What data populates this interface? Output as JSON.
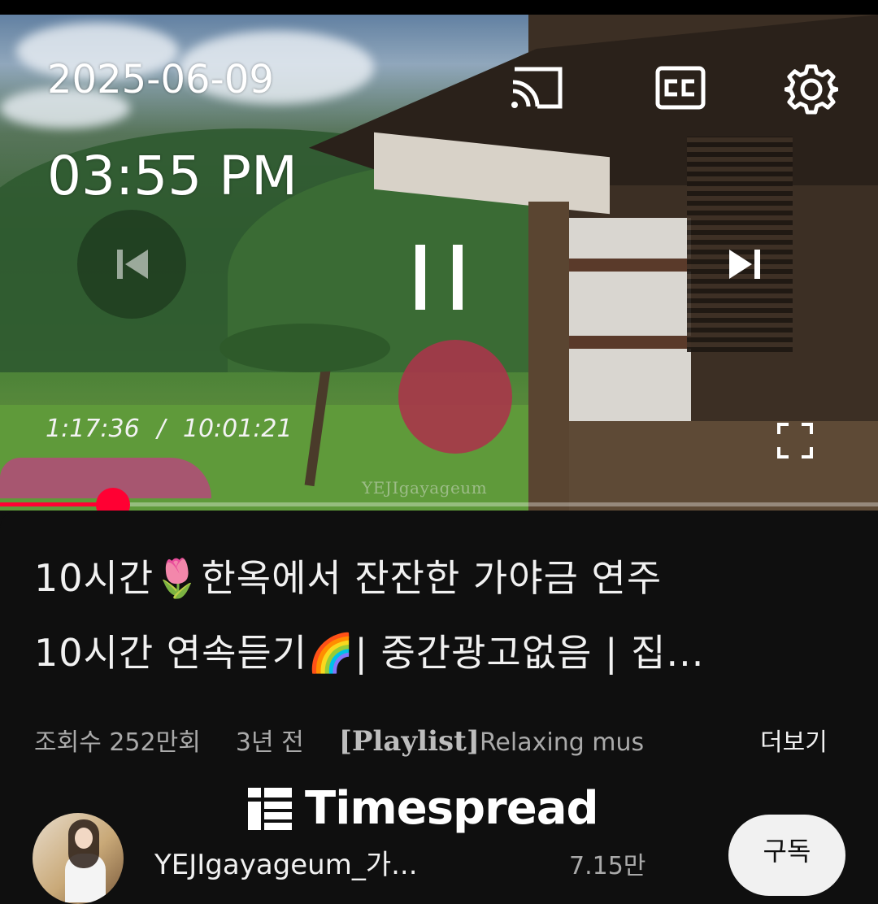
{
  "overlay": {
    "date": "2025-06-09",
    "time": "03:55 PM"
  },
  "player": {
    "elapsed": "1:17:36",
    "duration": "10:01:21",
    "time_separator": "/",
    "progress_fraction": 0.129,
    "watermark": "YEJIgayageum",
    "icons": {
      "cast": "cast-icon",
      "captions": "cc-icon",
      "settings": "gear-icon",
      "previous": "skip-previous-icon",
      "pause": "pause-icon",
      "next": "skip-next-icon",
      "fullscreen": "fullscreen-icon"
    },
    "colors": {
      "progress": "#ff0033"
    }
  },
  "video": {
    "title_line1": "10시간🌷한옥에서 잔잔한 가야금 연주",
    "title_line2": "10시간 연속듣기🌈| 중간광고없음 | 집...",
    "views": "조회수 252만회",
    "age": "3년 전",
    "tag": "[Playlist]",
    "desc_snippet": "Relaxing mus",
    "more_label": "더보기"
  },
  "brand": {
    "name": "Timespread"
  },
  "channel": {
    "name": "YEJIgayageum_가...",
    "subscribers": "7.15만",
    "subscribe_label": "구독"
  }
}
